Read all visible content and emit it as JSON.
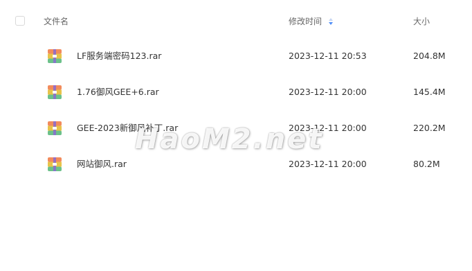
{
  "header": {
    "name_label": "文件名",
    "time_label": "修改时间",
    "size_label": "大小"
  },
  "files": [
    {
      "name": "LF服务端密码123.rar",
      "modified": "2023-12-11 20:53",
      "size": "204.8M"
    },
    {
      "name": "1.76御风GEE+6.rar",
      "modified": "2023-12-11 20:00",
      "size": "145.4M"
    },
    {
      "name": "GEE-2023新御风补丁.rar",
      "modified": "2023-12-11 20:00",
      "size": "220.2M"
    },
    {
      "name": "网站御风.rar",
      "modified": "2023-12-11 20:00",
      "size": "80.2M"
    }
  ],
  "watermark": "HaoM2.net",
  "colors": {
    "header_text": "#666666",
    "row_text": "#333333",
    "sort_icon": "#4e8ef7"
  }
}
